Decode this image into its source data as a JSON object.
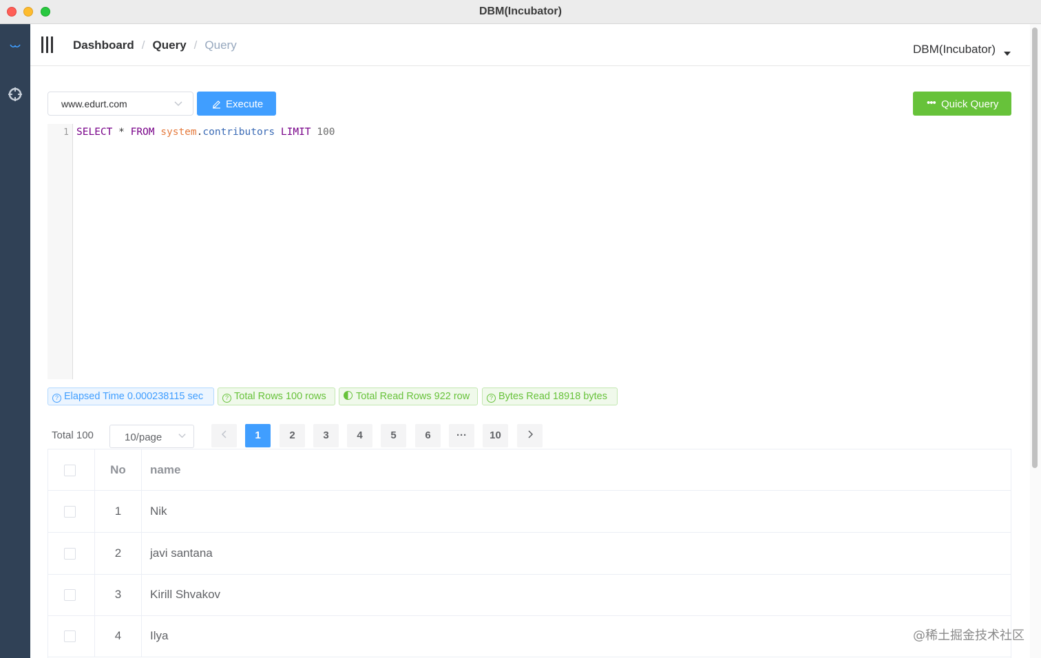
{
  "window": {
    "title": "DBM(Incubator)"
  },
  "navbar": {
    "breadcrumb": [
      "Dashboard",
      "Query",
      "Query"
    ],
    "user_menu": "DBM(Incubator)"
  },
  "toolbar": {
    "datasource_value": "www.edurt.com",
    "execute_label": "Execute",
    "quick_query_label": "Quick Query"
  },
  "editor": {
    "line_number": "1",
    "sql": {
      "select": "SELECT",
      "star": "*",
      "from": "FROM",
      "schema": "system",
      "dot": ".",
      "table": "contributors",
      "limit": "LIMIT",
      "limit_value": "100"
    }
  },
  "stats": {
    "elapsed": "Elapsed Time 0.000238115 sec",
    "total_rows": "Total Rows 100 rows",
    "total_read_rows": "Total Read Rows 922 row",
    "bytes_read": "Bytes Read 18918 bytes"
  },
  "pagination": {
    "total": "Total 100",
    "page_size": "10/page",
    "pages": [
      "1",
      "2",
      "3",
      "4",
      "5",
      "6"
    ],
    "ellipsis": "···",
    "last_page": "10",
    "current_page": "1"
  },
  "table": {
    "columns": [
      "No",
      "name"
    ],
    "rows": [
      {
        "no": "1",
        "name": "Nik"
      },
      {
        "no": "2",
        "name": "javi santana"
      },
      {
        "no": "3",
        "name": "Kirill Shvakov"
      },
      {
        "no": "4",
        "name": "Ilya"
      }
    ]
  },
  "watermark": "@稀土掘金技术社区",
  "colors": {
    "sidebar": "#304156",
    "primary": "#409eff",
    "success": "#67c23a"
  },
  "icons": {
    "sidebar_top": "logo-icon",
    "sidebar_second": "settings-icon",
    "execute": "edit-icon",
    "quick_query": "more-icon"
  }
}
